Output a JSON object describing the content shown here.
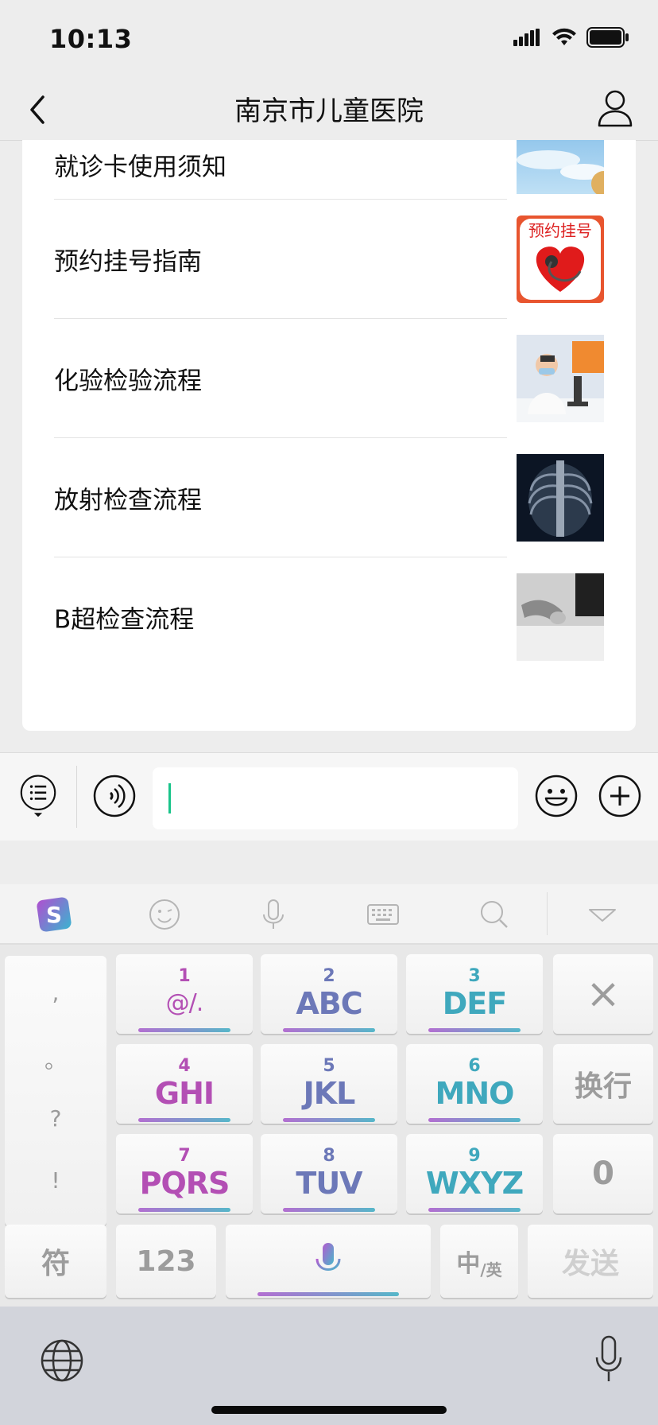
{
  "status_bar": {
    "time": "10:13"
  },
  "nav": {
    "title": "南京市儿童医院"
  },
  "articles": [
    {
      "label": "就诊卡使用须知"
    },
    {
      "label": "预约挂号指南",
      "thumb_text": "预约挂号"
    },
    {
      "label": "化验检验流程"
    },
    {
      "label": "放射检查流程"
    },
    {
      "label": "B超检查流程"
    }
  ],
  "input": {
    "value": ""
  },
  "keyboard": {
    "punct": [
      ",",
      "。",
      "?",
      "!"
    ],
    "keys": [
      {
        "num": "1",
        "letters": "@/."
      },
      {
        "num": "2",
        "letters": "ABC"
      },
      {
        "num": "3",
        "letters": "DEF"
      },
      {
        "num": "4",
        "letters": "GHI"
      },
      {
        "num": "5",
        "letters": "JKL"
      },
      {
        "num": "6",
        "letters": "MNO"
      },
      {
        "num": "7",
        "letters": "PQRS"
      },
      {
        "num": "8",
        "letters": "TUV"
      },
      {
        "num": "9",
        "letters": "WXYZ"
      }
    ],
    "delete_icon": "×",
    "newline_label": "换行",
    "zero_label": "0",
    "symbol_label": "符",
    "numbers_label": "123",
    "lang_main": "中",
    "lang_sub": "/英",
    "send_label": "发送"
  },
  "colors": {
    "pink": "#b34fb4",
    "blue": "#6c78b8",
    "teal": "#3fa8bd",
    "caret": "#19c48a"
  }
}
